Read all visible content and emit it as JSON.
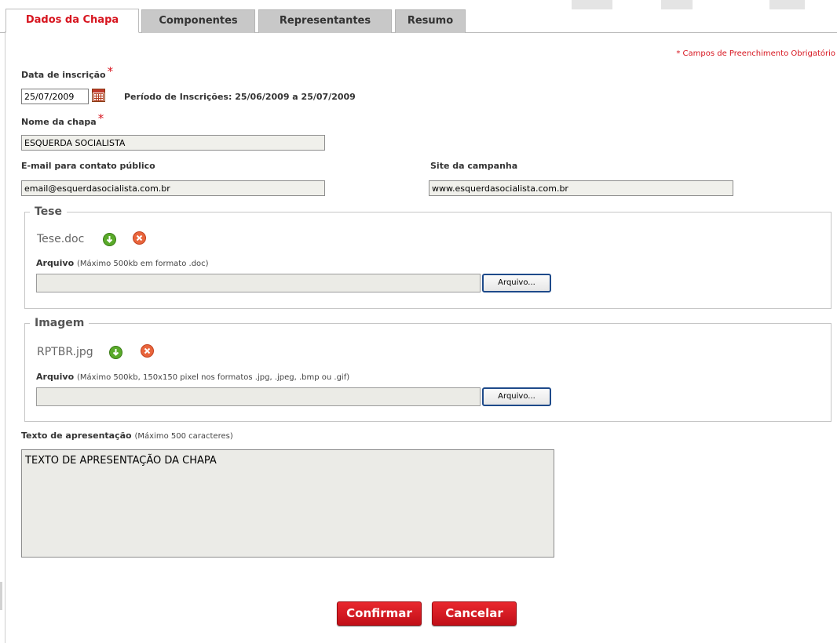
{
  "tabs": [
    {
      "label": "Dados da Chapa",
      "active": true
    },
    {
      "label": "Componentes",
      "active": false
    },
    {
      "label": "Representantes",
      "active": false
    },
    {
      "label": "Resumo",
      "active": false
    }
  ],
  "required_note": "* Campos de Preenchimento Obrigatório",
  "form": {
    "date_label": "Data de inscrição",
    "date_value": "25/07/2009",
    "period": "Período de Inscrições: 25/06/2009 a 25/07/2009",
    "name_label": "Nome da chapa",
    "name_value": "ESQUERDA SOCIALISTA",
    "email_label": "E-mail para contato público",
    "email_value": "email@esquerdasocialista.com.br",
    "site_label": "Site da campanha",
    "site_value": "www.esquerdasocialista.com.br"
  },
  "tese": {
    "legend": "Tese",
    "filename": "Tese.doc",
    "file_label": "Arquivo",
    "file_hint": "(Máximo 500kb em formato .doc)",
    "button": "Arquivo..."
  },
  "imagem": {
    "legend": "Imagem",
    "filename": "RPTBR.jpg",
    "file_label": "Arquivo",
    "file_hint": "(Máximo 500kb, 150x150 pixel nos formatos .jpg, .jpeg, .bmp ou .gif)",
    "button": "Arquivo..."
  },
  "apresentacao": {
    "label": "Texto de apresentação",
    "hint": "(Máximo 500 caracteres)",
    "value": "TEXTO DE APRESENTAÇÃO DA CHAPA"
  },
  "actions": {
    "confirm": "Confirmar",
    "cancel": "Cancelar"
  },
  "colors": {
    "accent": "#d7151f",
    "tab_inactive": "#c8c8c8",
    "input_bg": "#f0f0eb"
  },
  "icons": {
    "download": "download-arrow-icon",
    "delete": "delete-x-icon",
    "calendar": "calendar-icon"
  }
}
